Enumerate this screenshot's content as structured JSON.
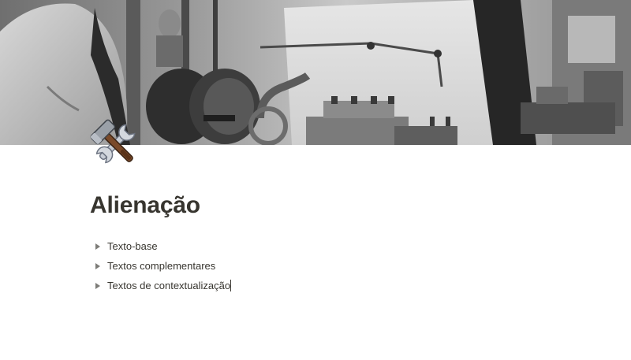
{
  "cover": {
    "description_icon": "cover-image",
    "tone": "grayscale"
  },
  "page_icon": {
    "name": "hammer-and-wrench-icon",
    "emoji": "🛠️"
  },
  "page": {
    "title": "Alienação"
  },
  "toggles": [
    {
      "label": "Texto-base",
      "icon": "toggle-arrow-icon"
    },
    {
      "label": "Textos complementares",
      "icon": "toggle-arrow-icon"
    },
    {
      "label": "Textos de contextualização",
      "icon": "toggle-arrow-icon"
    }
  ],
  "colors": {
    "text": "#37352f",
    "arrow": "#7d7c78",
    "background": "#ffffff"
  }
}
